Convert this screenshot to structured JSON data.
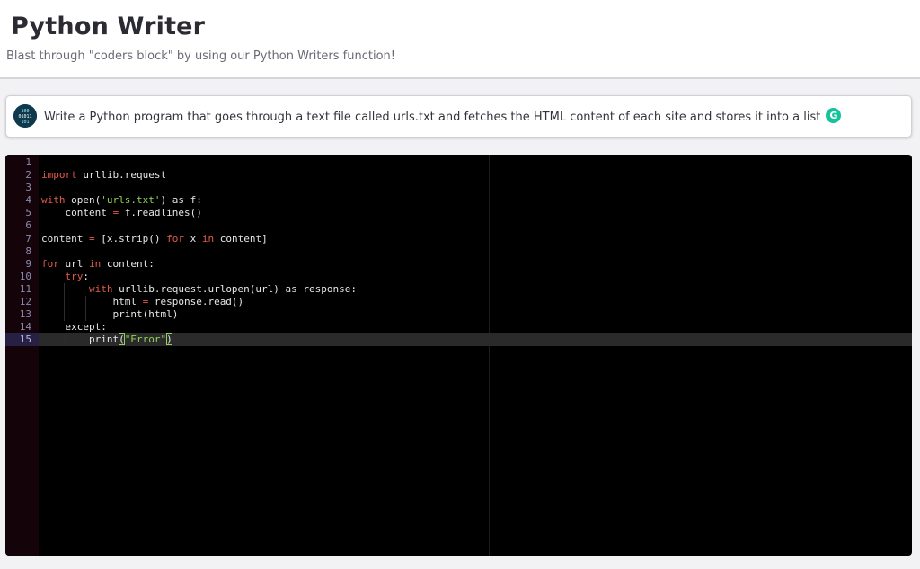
{
  "header": {
    "title": "Python Writer",
    "subtitle": "Blast through \"coders block\" by using our Python Writers function!"
  },
  "prompt": {
    "text": "Write a Python program that goes through a text file called urls.txt and fetches the HTML content of each site and stores it into a list",
    "avatar_icon": "binary-code-avatar",
    "badge_icon": "grammarly-icon",
    "badge_letter": "G"
  },
  "editor": {
    "theme": "dark",
    "active_line": 15,
    "lines": [
      {
        "n": "1",
        "tokens": []
      },
      {
        "n": "2",
        "tokens": [
          [
            "kw",
            "import"
          ],
          [
            "txt",
            " urllib.request"
          ]
        ]
      },
      {
        "n": "3",
        "tokens": []
      },
      {
        "n": "4",
        "tokens": [
          [
            "kw",
            "with"
          ],
          [
            "txt",
            " open("
          ],
          [
            "str",
            "'urls.txt'"
          ],
          [
            "txt",
            ") as f:"
          ]
        ]
      },
      {
        "n": "5",
        "tokens": [
          [
            "txt",
            "    content "
          ],
          [
            "op",
            "="
          ],
          [
            "txt",
            " f.readlines()"
          ]
        ]
      },
      {
        "n": "6",
        "tokens": []
      },
      {
        "n": "7",
        "tokens": [
          [
            "txt",
            "content "
          ],
          [
            "op",
            "="
          ],
          [
            "txt",
            " [x.strip() "
          ],
          [
            "kw",
            "for"
          ],
          [
            "txt",
            " x "
          ],
          [
            "kw",
            "in"
          ],
          [
            "txt",
            " content]"
          ]
        ]
      },
      {
        "n": "8",
        "tokens": []
      },
      {
        "n": "9",
        "tokens": [
          [
            "kw",
            "for"
          ],
          [
            "txt",
            " url "
          ],
          [
            "kw",
            "in"
          ],
          [
            "txt",
            " content:"
          ]
        ]
      },
      {
        "n": "10",
        "tokens": [
          [
            "txt",
            "    "
          ],
          [
            "kw",
            "try"
          ],
          [
            "txt",
            ":"
          ]
        ]
      },
      {
        "n": "11",
        "tokens": [
          [
            "txt",
            "        "
          ],
          [
            "kw",
            "with"
          ],
          [
            "txt",
            " urllib.request.urlopen(url) as response:"
          ]
        ]
      },
      {
        "n": "12",
        "tokens": [
          [
            "txt",
            "            html "
          ],
          [
            "op",
            "="
          ],
          [
            "txt",
            " response.read()"
          ]
        ]
      },
      {
        "n": "13",
        "tokens": [
          [
            "txt",
            "            print(html)"
          ]
        ]
      },
      {
        "n": "14",
        "tokens": [
          [
            "txt",
            "    except:"
          ]
        ]
      },
      {
        "n": "15",
        "tokens": [
          [
            "txt",
            "        print"
          ],
          [
            "hl",
            "("
          ],
          [
            "str",
            "\"Error\""
          ],
          [
            "hl",
            ")"
          ]
        ]
      }
    ]
  }
}
